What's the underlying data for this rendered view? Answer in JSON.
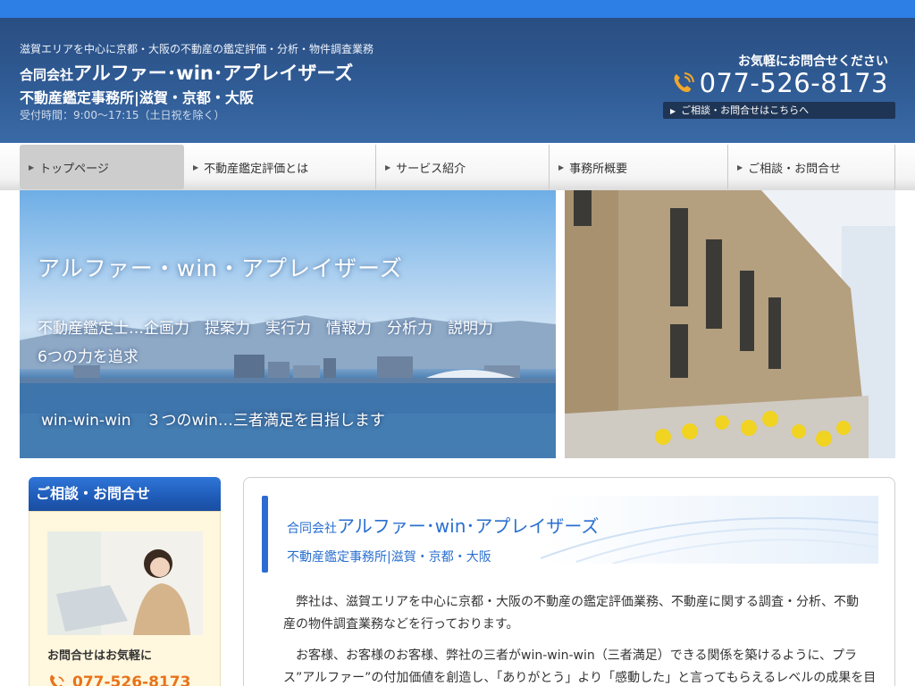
{
  "header": {
    "tagline": "滋賀エリアを中心に京都・大阪の不動産の鑑定評価・分析・物件調査業務",
    "company_prefix": "合同会社",
    "company_name": "アルファー･win･アプレイザーズ",
    "office": "不動産鑑定事務所|滋賀・京都・大阪",
    "hours": "受付時間：9:00～17:15（土日祝を除く）",
    "contact_label": "お気軽にお問合せください",
    "phone": "077-526-8173",
    "contact_link": "ご相談・お問合せはこちらへ"
  },
  "nav": {
    "items": [
      {
        "label": "トップページ"
      },
      {
        "label": "不動産鑑定評価とは"
      },
      {
        "label": "サービス紹介"
      },
      {
        "label": "事務所概要"
      },
      {
        "label": "ご相談・お問合せ"
      }
    ]
  },
  "hero": {
    "title": "アルファー・win・アプレイザーズ",
    "line1": "不動産鑑定士…企画力　提案力　実行力　情報力　分析力　説明力",
    "line2": "6つの力を追求",
    "line3": "win-win-win　３つのwin…三者満足を目指します"
  },
  "sidebar": {
    "heading": "ご相談・お問合せ",
    "label": "お問合せはお気軽に",
    "phone": "077-526-8173"
  },
  "main": {
    "company_prefix": "合同会社",
    "company_name": "アルファー･win･アプレイザーズ",
    "office": "不動産鑑定事務所|滋賀・京都・大阪",
    "p1_line1": "　弊社は、滋賀エリアを中心に京都・大阪の不動産の鑑定評価業務、不動産に関する調査・分析、不動",
    "p1_line2": "産の物件調査業務などを行っております。",
    "p2_line1": "　お客様、お客様のお客様、弊社の三者がwin-win-win（三者満足）できる関係を築けるように、プラ",
    "p2_line2": "ス”アルファー”の付加価値を創造し、「ありがとう」より「感動した」と言ってもらえるレベルの成果を目"
  },
  "colors": {
    "header_bg": "#2f5a93",
    "accent_blue": "#2a6fcf",
    "phone_orange": "#e8731a",
    "sidebar_bg": "#fff7de"
  }
}
